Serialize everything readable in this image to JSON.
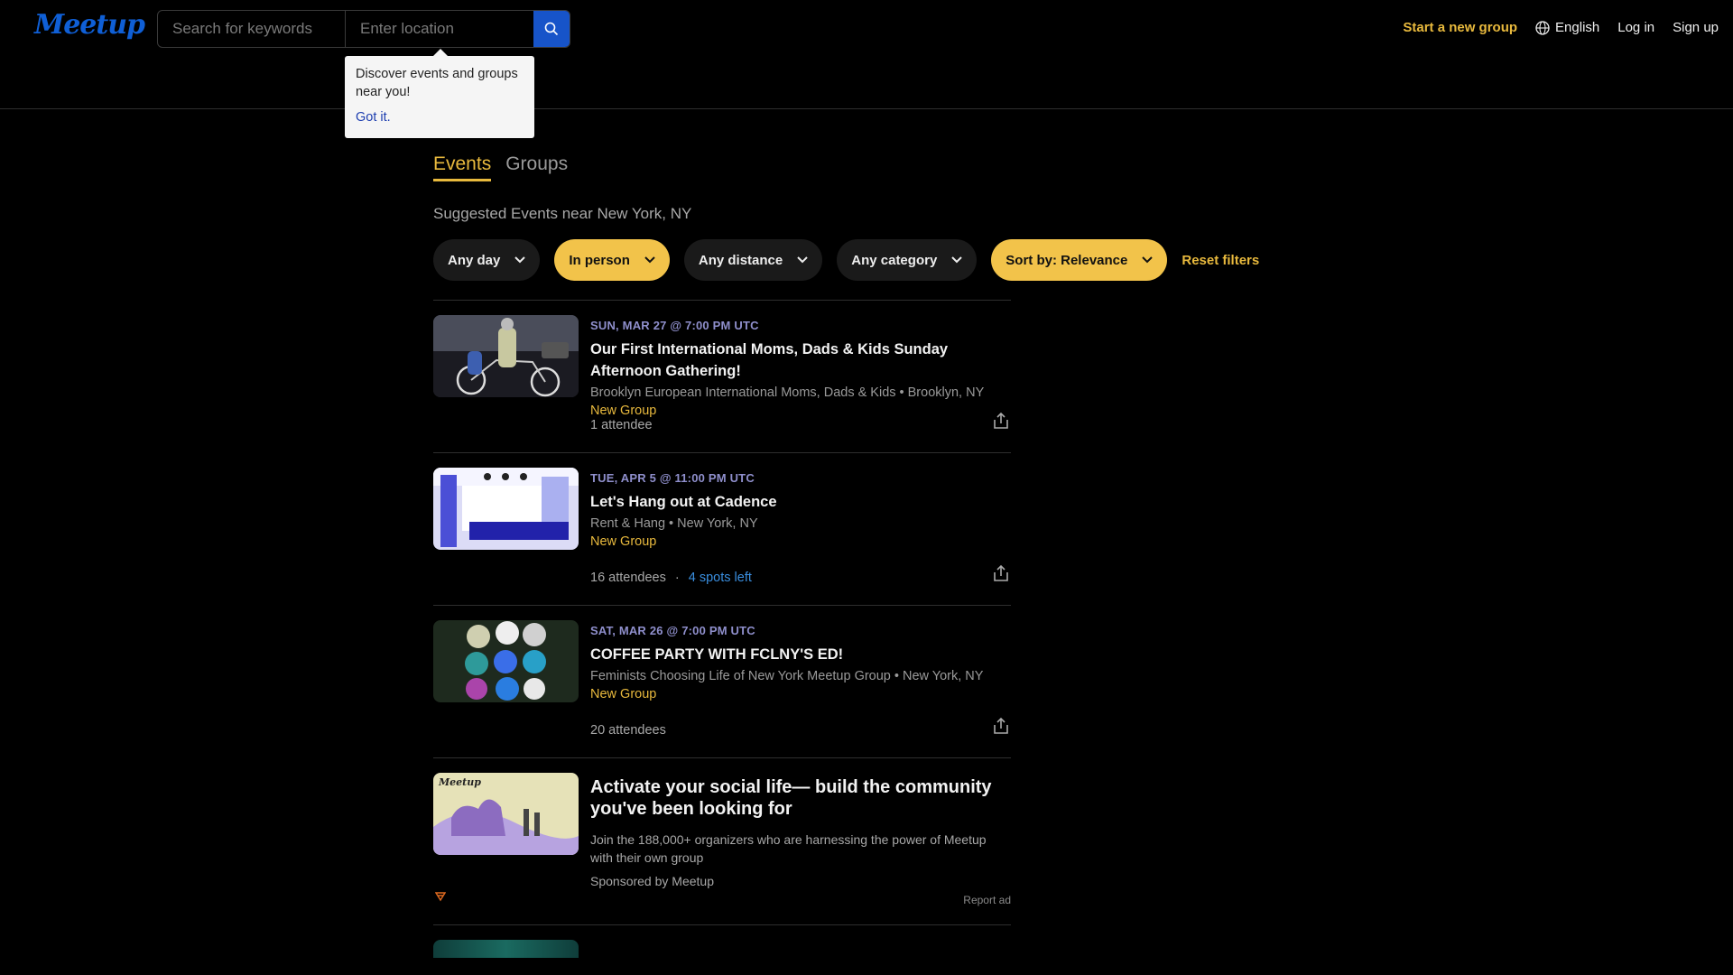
{
  "header": {
    "logo": "Meetup",
    "search": {
      "keyword_placeholder": "Search for keywords",
      "location_placeholder": "Enter location"
    },
    "nav": {
      "start_group": "Start a new group",
      "language": "English",
      "login": "Log in",
      "signup": "Sign up"
    }
  },
  "tooltip": {
    "text": "Discover events and groups near you!",
    "action": "Got it."
  },
  "tabs": [
    {
      "label": "Events",
      "active": true
    },
    {
      "label": "Groups",
      "active": false
    }
  ],
  "subtitle": "Suggested Events near New York, NY",
  "filters": {
    "day": "Any day",
    "type": "In person",
    "distance": "Any distance",
    "category": "Any category",
    "sort": "Sort by: Relevance",
    "reset": "Reset filters"
  },
  "events": [
    {
      "date": "SUN, MAR 27 @ 7:00 PM UTC",
      "title": "Our First International Moms, Dads & Kids Sunday Afternoon Gathering!",
      "group": "Brooklyn European International Moms, Dads & Kids • Brooklyn, NY",
      "badge": "New Group",
      "attendees": "1 attendee",
      "spots": ""
    },
    {
      "date": "TUE, APR 5 @ 11:00 PM UTC",
      "title": "Let's Hang out at Cadence",
      "group": "Rent & Hang • New York, NY",
      "badge": "New Group",
      "attendees": "16 attendees",
      "separator": "·",
      "spots": "4 spots left"
    },
    {
      "date": "SAT, MAR 26 @ 7:00 PM UTC",
      "title": "COFFEE PARTY WITH FCLNY'S ED!",
      "group": "Feminists Choosing Life of New York Meetup Group • New York, NY",
      "badge": "New Group",
      "attendees": "20 attendees",
      "spots": ""
    }
  ],
  "ad": {
    "logo": "Meetup",
    "title": "Activate your social life— build the community you've been looking for",
    "text": "Join the 188,000+ organizers who are harnessing the power of Meetup with their own group",
    "sponsor": "Sponsored by Meetup",
    "report": "Report ad"
  },
  "colors": {
    "accent": "#e8b93d",
    "brand_blue": "#1754c9",
    "date": "#8f8fcc",
    "spots": "#3a8fe0"
  }
}
